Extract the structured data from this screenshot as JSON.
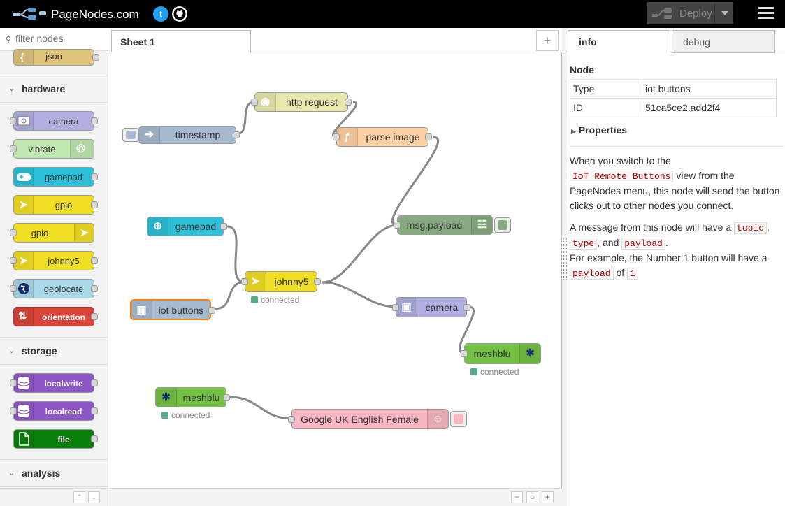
{
  "header": {
    "app_title": "PageNodes.com",
    "twitter_label": "t",
    "deploy_label": "Deploy"
  },
  "palette": {
    "filter_placeholder": "filter nodes",
    "top_node": "json",
    "categories": [
      {
        "label": "hardware",
        "nodes": [
          "camera",
          "vibrate",
          "gamepad",
          "gpio",
          "gpio",
          "johnny5",
          "geolocate",
          "orientation"
        ]
      },
      {
        "label": "storage",
        "nodes": [
          "localwrite",
          "localread",
          "file"
        ]
      },
      {
        "label": "analysis",
        "nodes": []
      }
    ]
  },
  "workspace": {
    "tab_label": "Sheet 1",
    "add_tab_label": "+",
    "zoom_out": "−",
    "zoom_reset": "○",
    "zoom_in": "+"
  },
  "flow": {
    "nodes": {
      "timestamp": "timestamp",
      "http_request": "http request",
      "parse_image": "parse image",
      "msg_payload": "msg.payload",
      "gamepad": "gamepad",
      "johnny5": "johnny5",
      "iot_buttons": "iot buttons",
      "camera": "camera",
      "meshblu_out": "meshblu",
      "meshblu_in": "meshblu",
      "speech": "Google UK English Female"
    },
    "status": {
      "johnny5": "connected",
      "meshblu_out": "connected",
      "meshblu_in": "connected"
    },
    "colors": {
      "function": "#fdd0a2",
      "http": "#e7e7ae",
      "inject": "#a6bbcf",
      "debug": "#87a980",
      "gamepad": "#2bc0d8",
      "johnny5": "#f0de24",
      "camera": "#b0b0e0",
      "meshblu": "#74c044",
      "speech": "#f7b6c2",
      "status_green": "#5a8"
    }
  },
  "sidebar": {
    "tab_info": "info",
    "tab_debug": "debug",
    "node_heading": "Node",
    "rows": [
      {
        "key": "Type",
        "value": "iot buttons"
      },
      {
        "key": "ID",
        "value": "51ca5ce2.add2f4"
      }
    ],
    "properties_label": "Properties",
    "description": {
      "p1_a": "When you switch to the",
      "p1_code": "IoT Remote Buttons",
      "p1_b": "view from the PageNodes menu, this node will send the button clicks out to other nodes you connect.",
      "p2_a": "A message from this node will have a",
      "p2_code1": "topic",
      "p2_sep1": ",",
      "p2_code2": "type",
      "p2_sep2": ", and",
      "p2_code3": "payload",
      "p2_end": ".",
      "p2_c": "For example, the Number 1 button will have a",
      "p2_code4": "payload",
      "p2_of": "of",
      "p2_code5": "1"
    }
  }
}
